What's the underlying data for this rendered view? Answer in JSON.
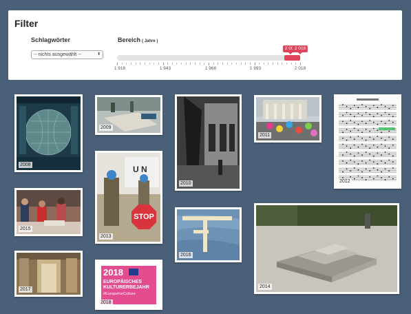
{
  "filter": {
    "title": "Filter",
    "keywords_label": "Schlagwörter",
    "keywords_value": "-- nichts ausgewählt --",
    "range_label": "Bereich",
    "range_unit": "( Jahre )",
    "range_min_value": "2 008",
    "range_max_value": "2 018",
    "accent_color": "#e0445a",
    "tick_labels": [
      "1 918",
      "1 943",
      "1 968",
      "1 993",
      "2 018"
    ]
  },
  "cards": [
    {
      "year": "2008",
      "icon": "globe-poster-image"
    },
    {
      "year": "2009",
      "icon": "street-installation-image"
    },
    {
      "year": "2010",
      "icon": "black-white-crane-image"
    },
    {
      "year": "2011",
      "icon": "balloons-crowd-image"
    },
    {
      "year": "2012",
      "icon": "sheet-music-image"
    },
    {
      "year": "2013",
      "icon": "un-soldiers-stop-image"
    },
    {
      "year": "2014",
      "icon": "concrete-memorial-image"
    },
    {
      "year": "2015",
      "icon": "market-people-image"
    },
    {
      "year": "2016",
      "icon": "letters-cross-image"
    },
    {
      "year": "2017",
      "icon": "interior-doorway-image"
    },
    {
      "year": "2018",
      "icon": "european-culture-year-poster"
    }
  ],
  "poster_2018": {
    "year_text": "2018",
    "line1": "EUROPÄISCHES",
    "line2": "KULTURERBEJAHR",
    "hashtag": "#EuropeForCulture"
  },
  "stop_sign_text": "STOP"
}
